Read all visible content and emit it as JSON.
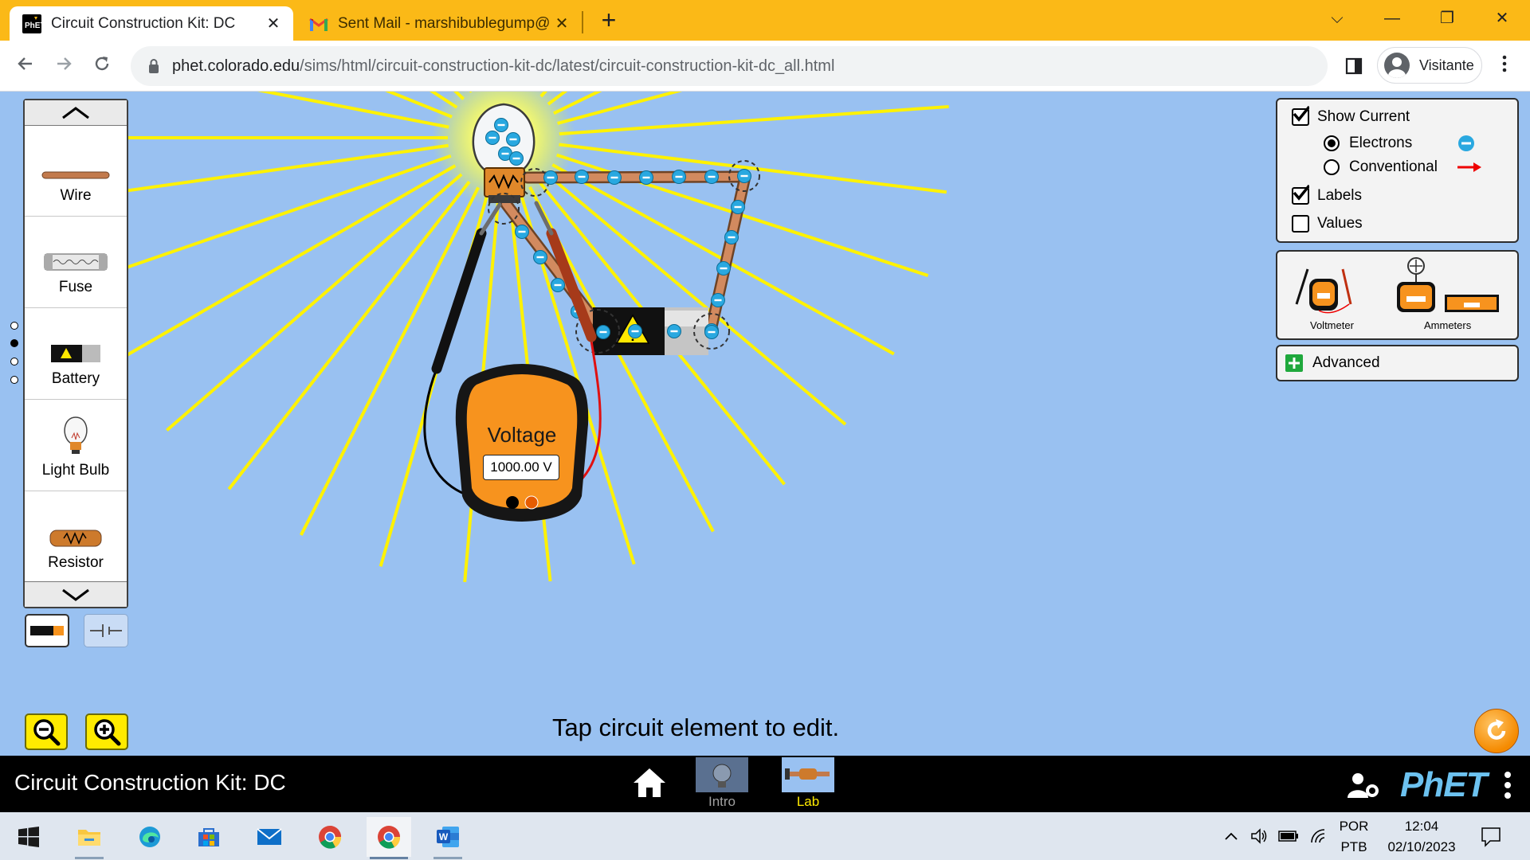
{
  "browser": {
    "tabs": [
      {
        "title": "Circuit Construction Kit: DC",
        "active": true,
        "favicon": "phet-favicon"
      },
      {
        "title": "Sent Mail - marshibublegump@",
        "active": false,
        "favicon": "gmail-icon"
      }
    ],
    "new_tab_symbol": "+",
    "close_symbol": "✕",
    "window_controls": {
      "collapse": "⌵",
      "minimize": "—",
      "restore": "❐",
      "close": "✕"
    },
    "url_host": "phet.colorado.edu",
    "url_path": "/sims/html/circuit-construction-kit-dc/latest/circuit-construction-kit-dc_all.html",
    "profile_label": "Visitante"
  },
  "sim": {
    "toolbox_items": [
      "Wire",
      "Fuse",
      "Battery",
      "Light Bulb",
      "Resistor"
    ],
    "page_indicator": {
      "pages": 4,
      "current_index": 1
    },
    "voltmeter": {
      "title": "Voltage",
      "reading": "1000.00 V"
    },
    "status_message": "Tap circuit element to edit.",
    "view_panel": {
      "show_current": {
        "label": "Show Current",
        "checked": true
      },
      "current_modes": [
        {
          "label": "Electrons",
          "selected": true
        },
        {
          "label": "Conventional",
          "selected": false
        }
      ],
      "labels": {
        "label": "Labels",
        "checked": true
      },
      "values": {
        "label": "Values",
        "checked": false
      }
    },
    "meters_panel": {
      "voltmeter_label": "Voltmeter",
      "ammeters_label": "Ammeters"
    },
    "advanced_label": "Advanced",
    "colors": {
      "background": "#99c1f1",
      "wire": "#c27a4c",
      "electron": "#29a8e0",
      "light_ray": "#fff200",
      "meter_orange": "#f7931e"
    }
  },
  "navbar": {
    "title": "Circuit Construction Kit: DC",
    "screens": [
      {
        "label": "Intro",
        "selected": false
      },
      {
        "label": "Lab",
        "selected": true
      }
    ],
    "logo": "PhET"
  },
  "taskbar": {
    "apps": [
      "start-icon",
      "file-explorer-icon",
      "edge-icon",
      "store-icon",
      "mail-icon",
      "chrome-icon",
      "chrome-icon",
      "word-icon"
    ],
    "lang_top": "POR",
    "lang_bottom": "PTB",
    "time": "12:04",
    "date": "02/10/2023"
  }
}
